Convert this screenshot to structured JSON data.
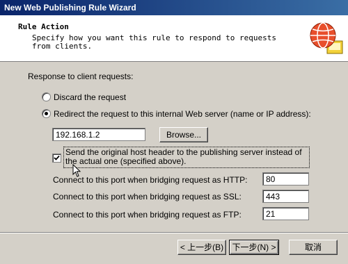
{
  "window": {
    "title": "New Web Publishing Rule Wizard"
  },
  "header": {
    "title": "Rule Action",
    "description": "Specify how you want this rule to respond to requests from clients.",
    "icon": "globe-icon"
  },
  "main": {
    "response_label": "Response to client requests:",
    "radio_discard": {
      "label": "Discard the request",
      "selected": false
    },
    "radio_redirect": {
      "label": "Redirect the request to this internal Web server (name or IP address):",
      "selected": true
    },
    "server_input": {
      "value": "192.168.1.2"
    },
    "browse_label": "Browse...",
    "host_header": {
      "label": "Send the original host header to the publishing server instead of the actual one (specified above).",
      "checked": true
    },
    "http_port": {
      "label": "Connect to this port when bridging request as HTTP:",
      "value": "80"
    },
    "ssl_port": {
      "label": "Connect to this port when bridging request as SSL:",
      "value": "443"
    },
    "ftp_port": {
      "label": "Connect to this port when bridging request as FTP:",
      "value": "21"
    }
  },
  "footer": {
    "back_label": "< 上一步(B)",
    "next_label": "下一步(N) >",
    "cancel_label": "取消"
  }
}
